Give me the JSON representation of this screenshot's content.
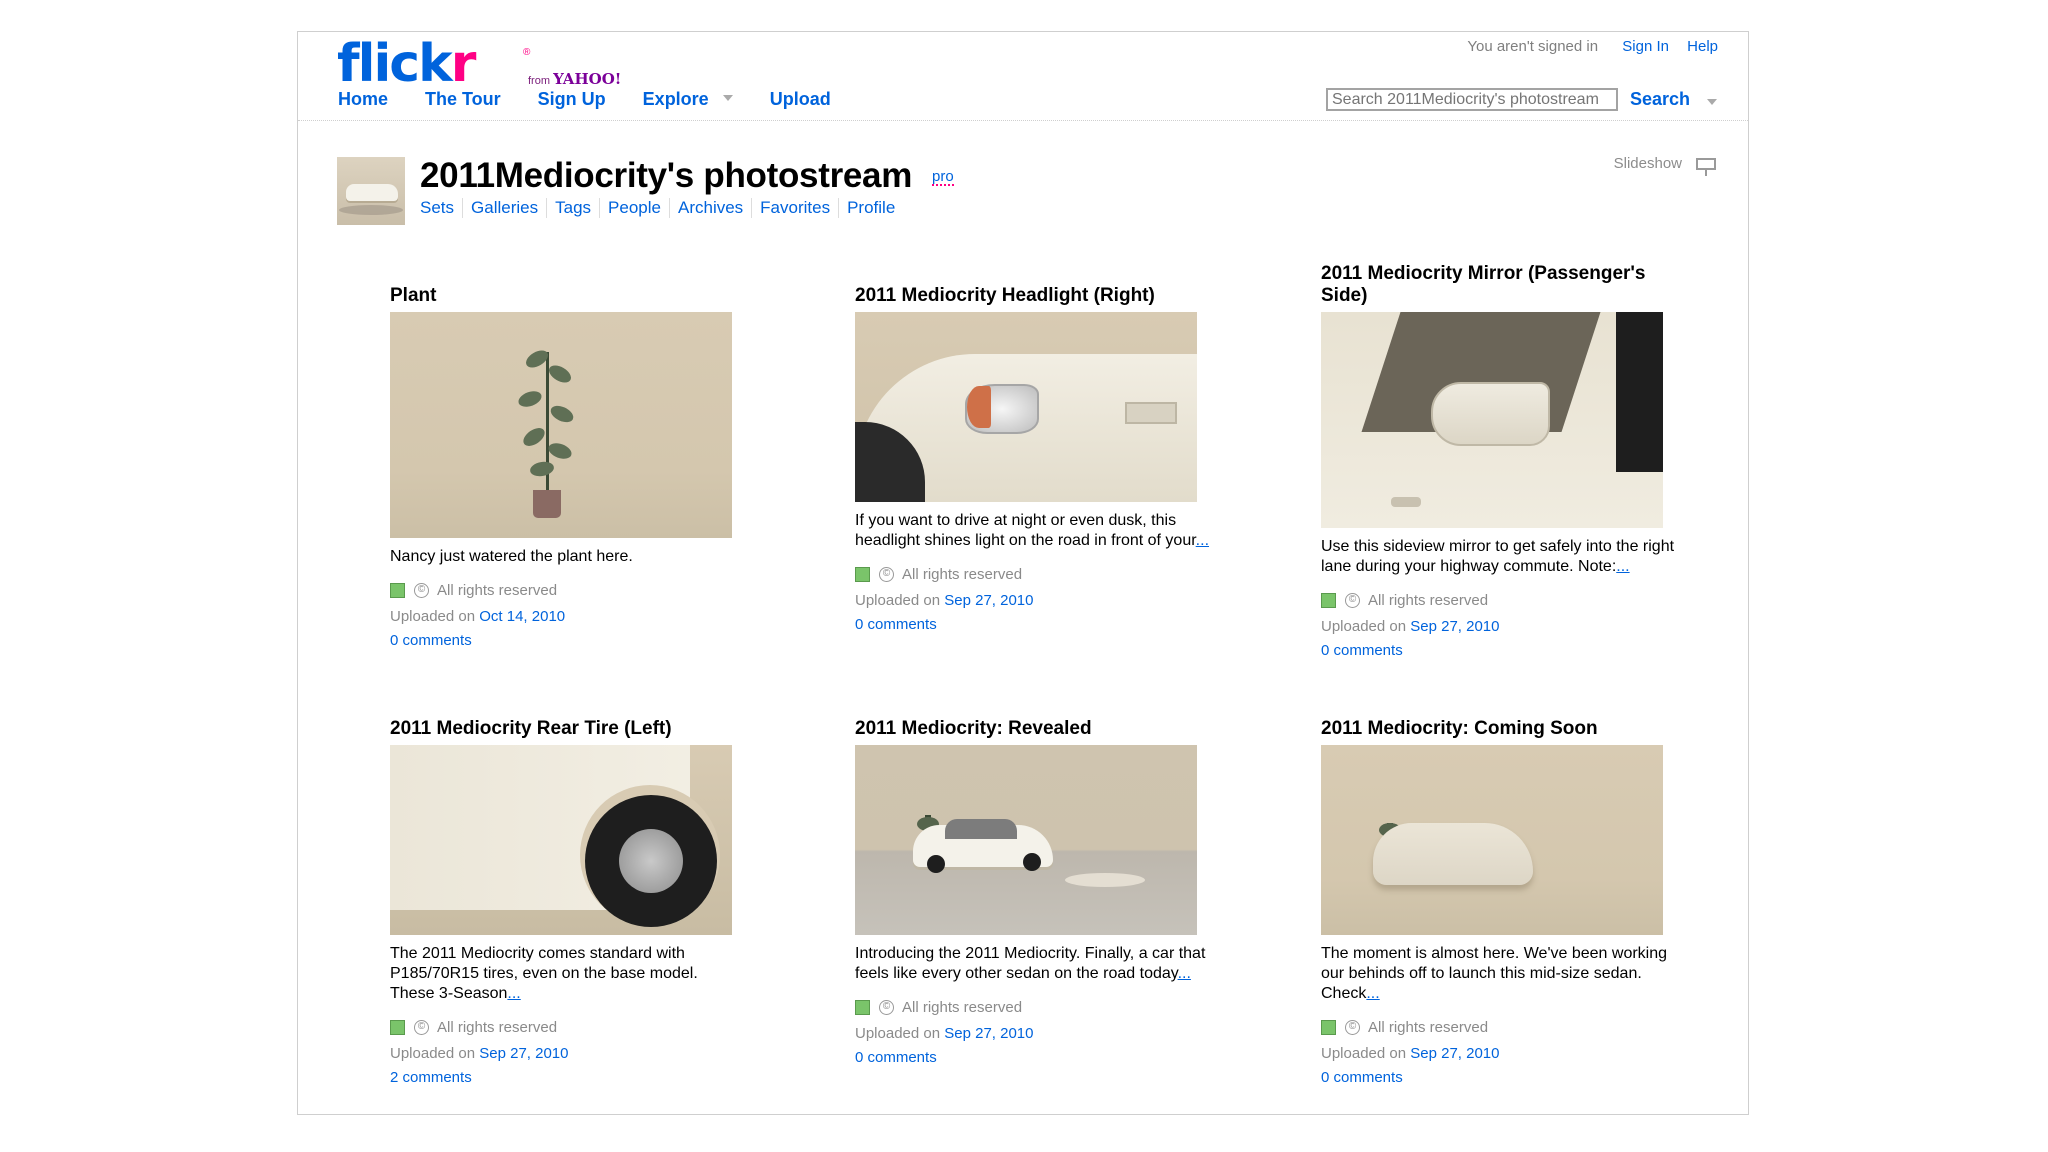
{
  "header": {
    "logo_text": "flickr",
    "logo_sub": "from YAHOO!",
    "nav": [
      "Home",
      "The Tour",
      "Sign Up",
      "Explore",
      "Upload"
    ],
    "signed_out_text": "You aren't signed in",
    "sign_in": "Sign In",
    "help": "Help",
    "search_placeholder": "Search 2011Mediocrity's photostream",
    "search_button": "Search"
  },
  "profile": {
    "title": "2011Mediocrity's photostream",
    "pro_badge": "pro",
    "subnav": [
      "Sets",
      "Galleries",
      "Tags",
      "People",
      "Archives",
      "Favorites",
      "Profile"
    ],
    "slideshow": "Slideshow"
  },
  "photos": [
    {
      "title": "Plant",
      "description": "Nancy just watered the plant here.",
      "more": "",
      "license": "All rights reserved",
      "uploaded_prefix": "Uploaded on",
      "date": "Oct 14, 2010",
      "comments": "0 comments"
    },
    {
      "title": "2011 Mediocrity Headlight (Right)",
      "description": "If you want to drive at night or even dusk, this headlight shines light on the road in front of your",
      "more": "...",
      "license": "All rights reserved",
      "uploaded_prefix": "Uploaded on",
      "date": "Sep 27, 2010",
      "comments": "0 comments"
    },
    {
      "title": "2011 Mediocrity Mirror (Passenger's Side)",
      "description": "Use this sideview mirror to get safely into the right lane during your highway commute. Note:",
      "more": "...",
      "license": "All rights reserved",
      "uploaded_prefix": "Uploaded on",
      "date": "Sep 27, 2010",
      "comments": "0 comments"
    },
    {
      "title": "2011 Mediocrity Rear Tire (Left)",
      "description": "The 2011 Mediocrity comes standard with P185/70R15 tires, even on the base model. These 3-Season",
      "more": "...",
      "license": "All rights reserved",
      "uploaded_prefix": "Uploaded on",
      "date": "Sep 27, 2010",
      "comments": "2 comments"
    },
    {
      "title": "2011 Mediocrity: Revealed",
      "description": "Introducing the 2011 Mediocrity. Finally, a car that feels like every other sedan on the road today",
      "more": "...",
      "license": "All rights reserved",
      "uploaded_prefix": "Uploaded on",
      "date": "Sep 27, 2010",
      "comments": "0 comments"
    },
    {
      "title": "2011 Mediocrity: Coming Soon",
      "description": "The moment is almost here. We've been working our behinds off to launch this mid-size sedan. Check",
      "more": "...",
      "license": "All rights reserved",
      "uploaded_prefix": "Uploaded on",
      "date": "Sep 27, 2010",
      "comments": "0 comments"
    }
  ],
  "colors": {
    "link": "#0063dc",
    "logo_pink": "#ff0084",
    "license_green": "#7ac46a",
    "muted": "#8a8a8a"
  }
}
